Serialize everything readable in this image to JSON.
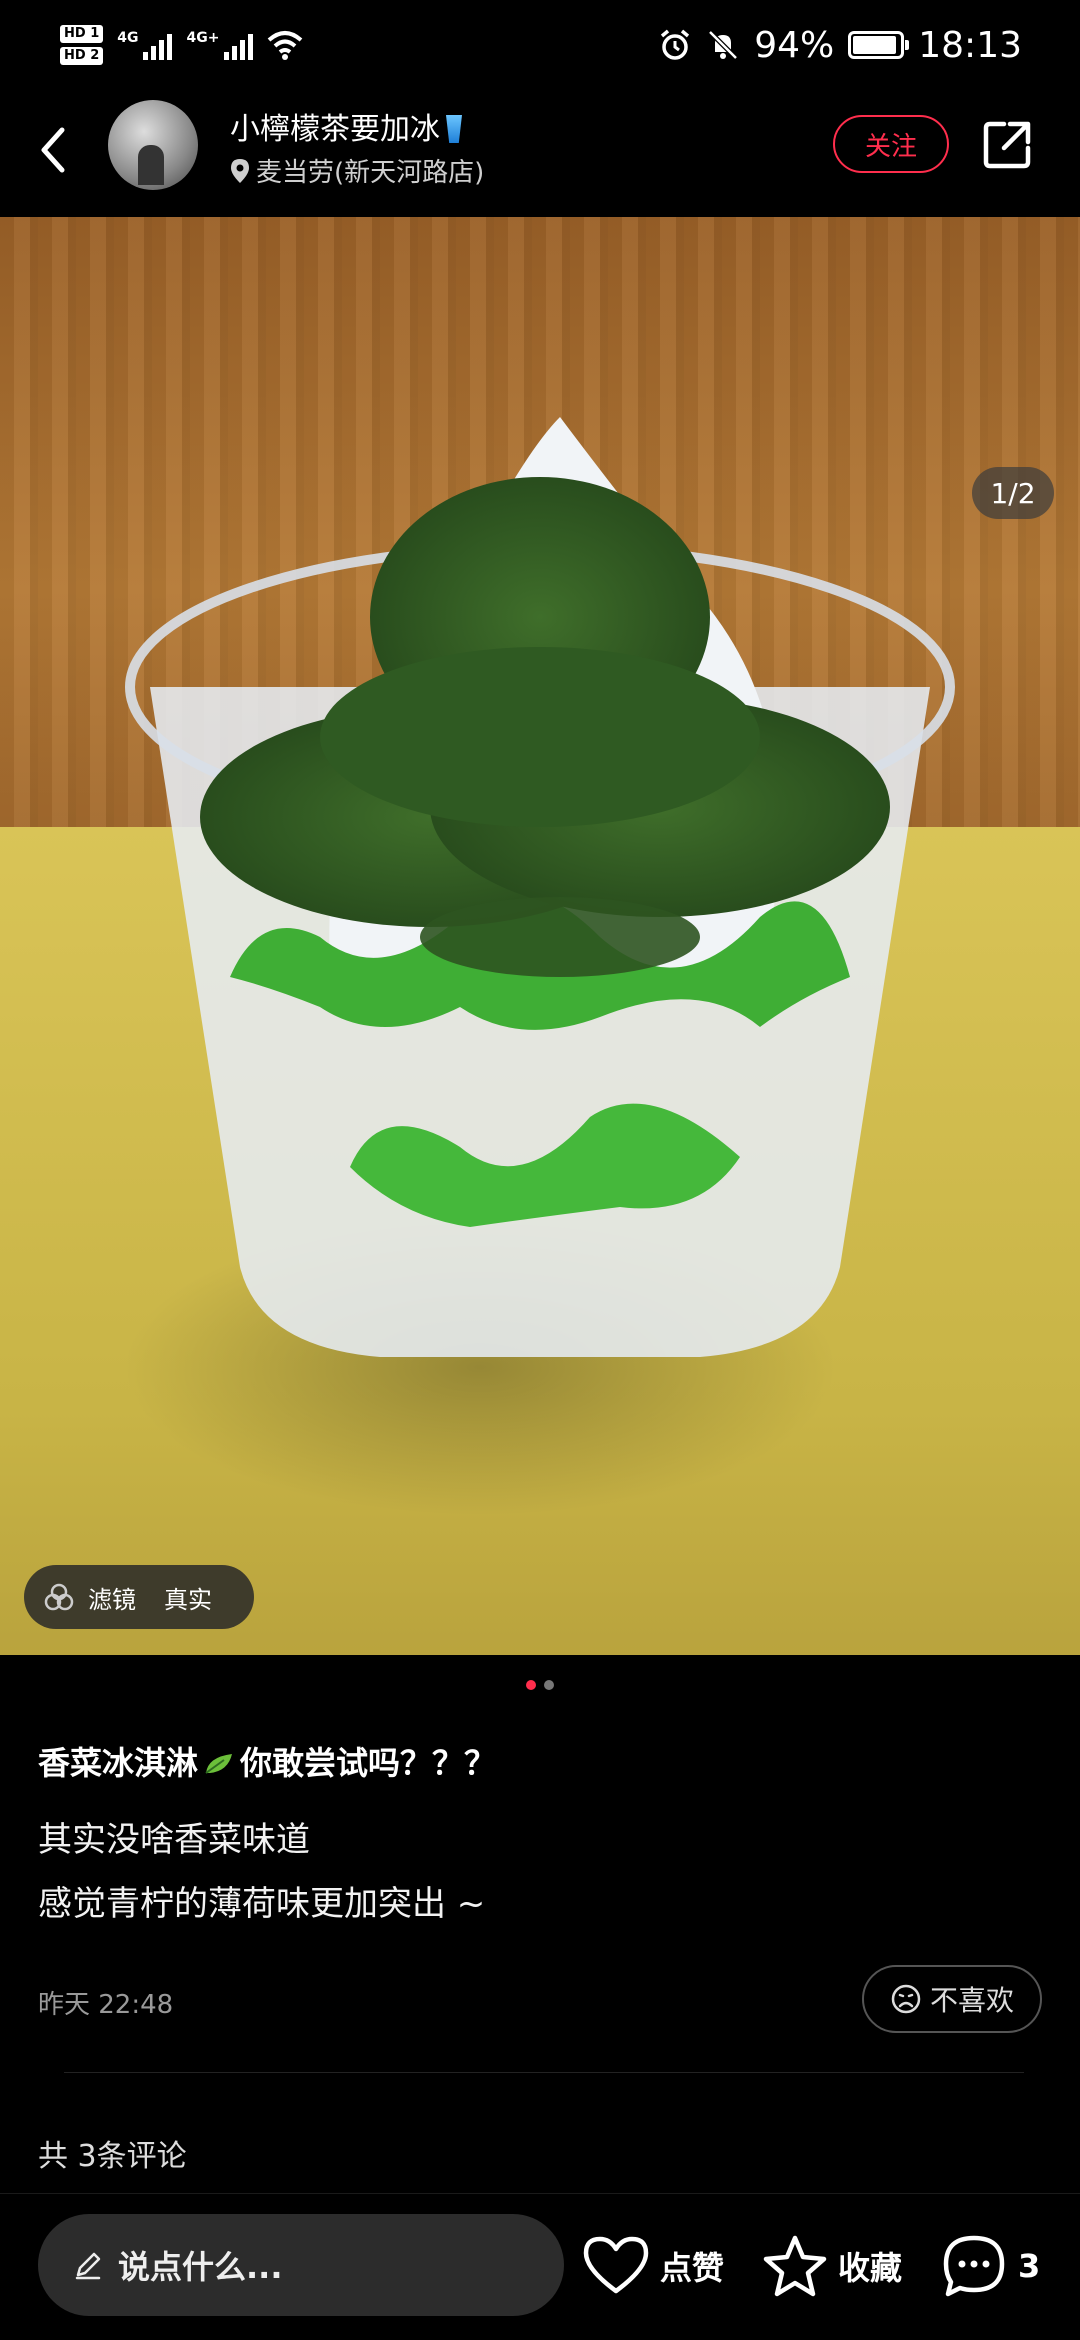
{
  "status_bar": {
    "hd1": "HD 1",
    "hd2": "HD 2",
    "net1": "4G",
    "net2": "4G+",
    "battery": "94%",
    "battery_level": 0.94,
    "time": "18:13"
  },
  "header": {
    "username": "小檸檬茶要加冰",
    "location": "麦当劳(新天河路店)",
    "follow_label": "关注"
  },
  "media": {
    "counter": "1/2",
    "filter_label": "滤镜",
    "filter_value": "真实",
    "page_count": 2,
    "current_page": 1
  },
  "post": {
    "title_part1": "香菜冰淇淋",
    "title_part2": "你敢尝试吗？？？",
    "body_line1": "其实没啥香菜味道",
    "body_line2": "感觉青柠的薄荷味更加突出 ~",
    "time": "昨天 22:48",
    "dislike_label": "不喜欢",
    "comments_summary": "共 3条评论"
  },
  "bottom_bar": {
    "input_placeholder": "说点什么...",
    "like_label": "点赞",
    "collect_label": "收藏",
    "comment_count": "3"
  },
  "colors": {
    "accent": "#ff2e4d",
    "background": "#000000"
  }
}
